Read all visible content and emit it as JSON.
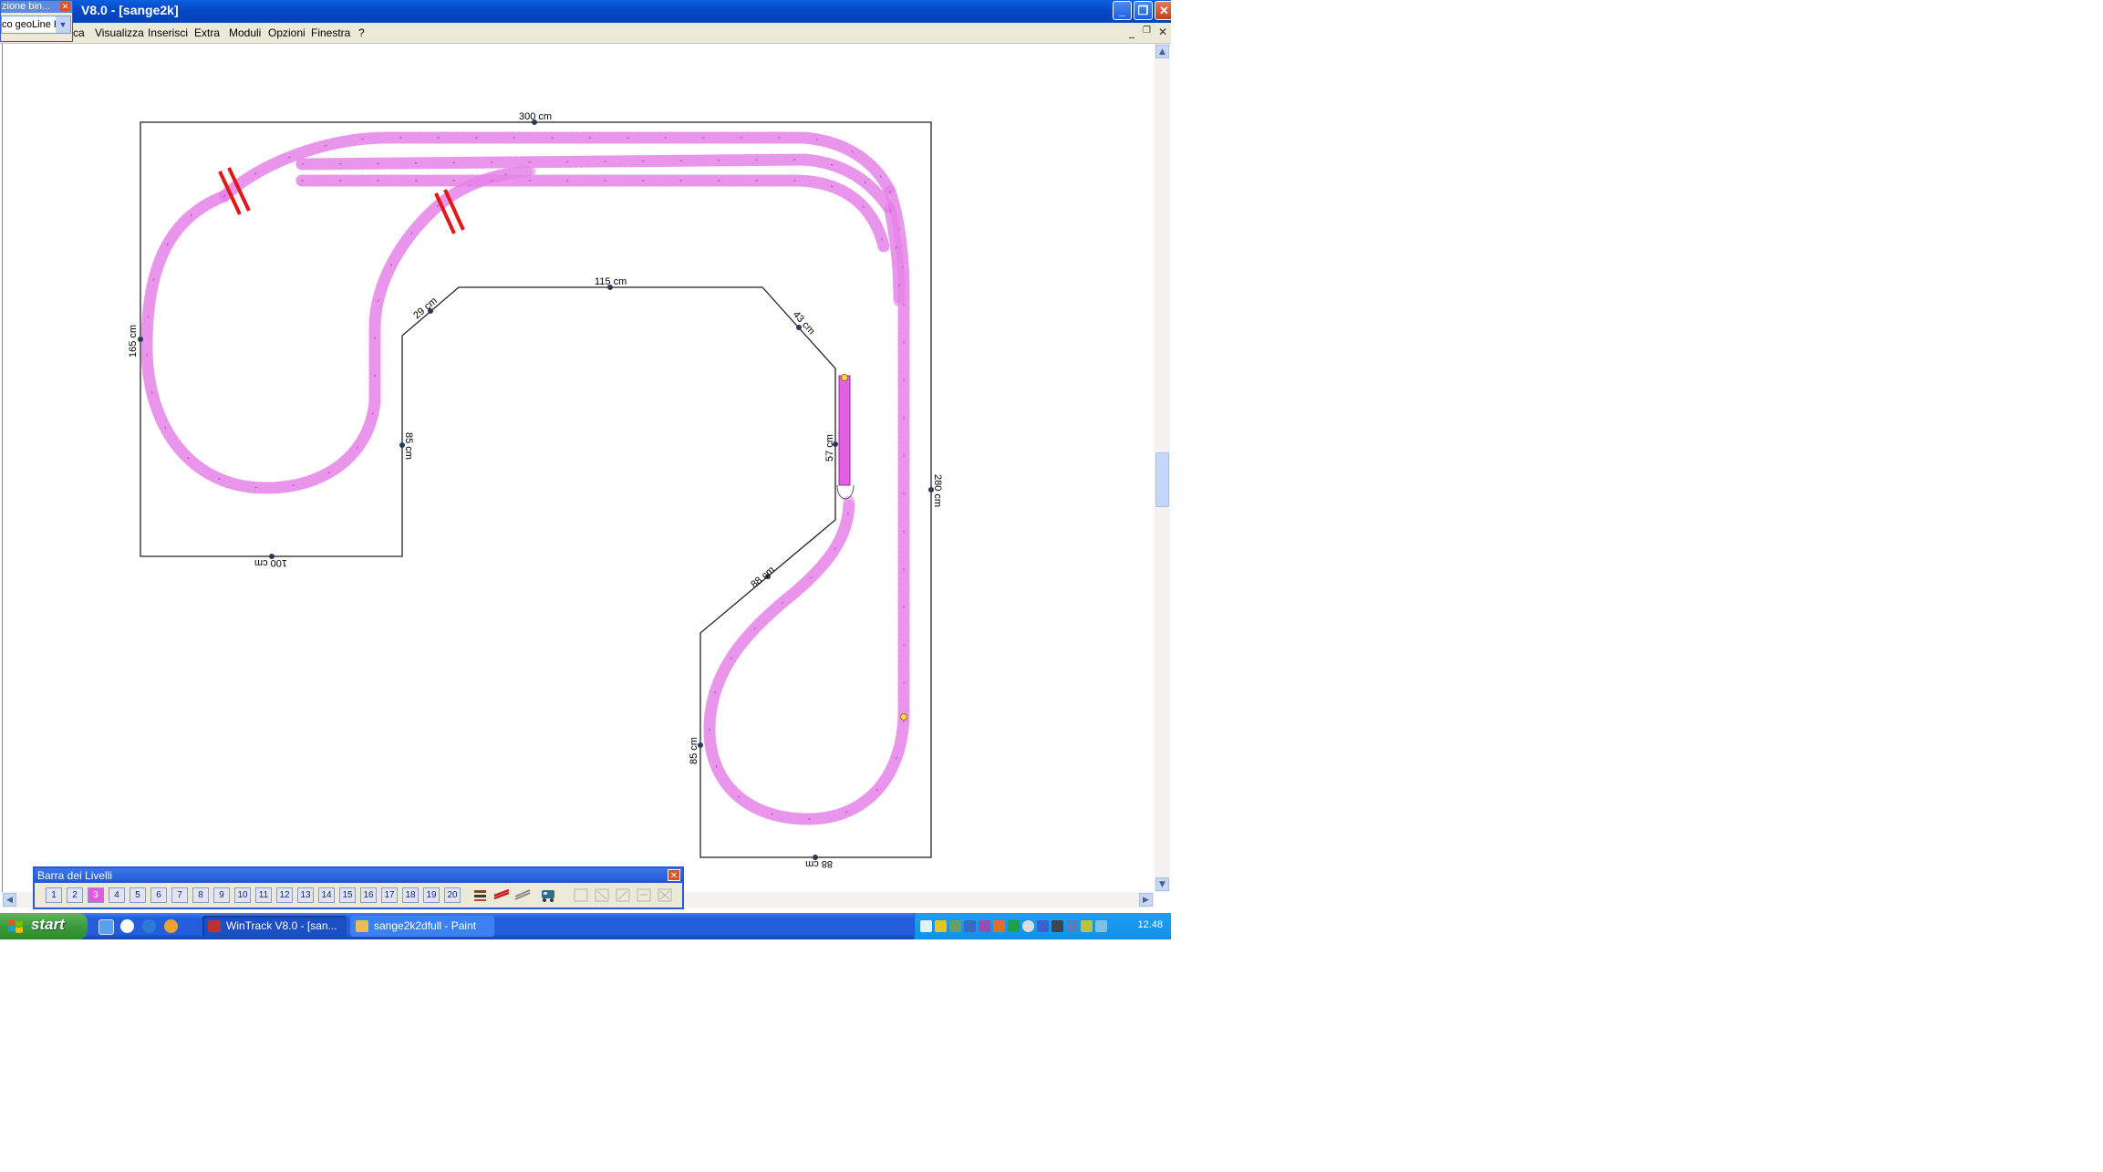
{
  "window": {
    "title": "V8.0 - [sange2k]",
    "minimize_symbol": "_",
    "restore_symbol": "❐",
    "close_symbol": "✕"
  },
  "mini_window": {
    "title": "zione bin...",
    "close_symbol": "✕",
    "select_value": "co geoLine H",
    "dropdown_icon": "chevron-down-icon"
  },
  "menu": {
    "items": [
      "ca",
      "Visualizza",
      "Inserisci",
      "Extra",
      "Moduli",
      "Opzioni",
      "Finestra",
      "?"
    ],
    "mdi_buttons": [
      "_",
      "❐",
      "✕"
    ]
  },
  "layout_drawing": {
    "dimension_labels": {
      "top": "300 cm",
      "left": "165 cm",
      "bottom_left": "100 cm",
      "inner_vertical": "85 cm",
      "diagonal_small": "29 cm",
      "inner_top": "115 cm",
      "diagonal_right": "43 cm",
      "inner_right": "57 cm",
      "right": "280 cm",
      "diagonal_lower": "88 cm",
      "lower_left": "85 cm",
      "bottom": "88 cm"
    },
    "colors": {
      "track": "#efb8f2",
      "track_sleeper": "#e27de6",
      "track_dots": "#c55ccd",
      "outline": "#222222",
      "buffer": "#e02020",
      "element": "#e060e0"
    }
  },
  "levels_bar": {
    "title": "Barra dei Livelli",
    "close_symbol": "✕",
    "levels": [
      "1",
      "2",
      "3",
      "4",
      "5",
      "6",
      "7",
      "8",
      "9",
      "10",
      "11",
      "12",
      "13",
      "14",
      "15",
      "16",
      "17",
      "18",
      "19",
      "20"
    ],
    "active_level": "3"
  },
  "taskbar": {
    "start_label": "start",
    "tasks": [
      "WinTrack V8.0 - [san...",
      "sange2k2dfull - Paint"
    ],
    "clock": "12.48"
  }
}
